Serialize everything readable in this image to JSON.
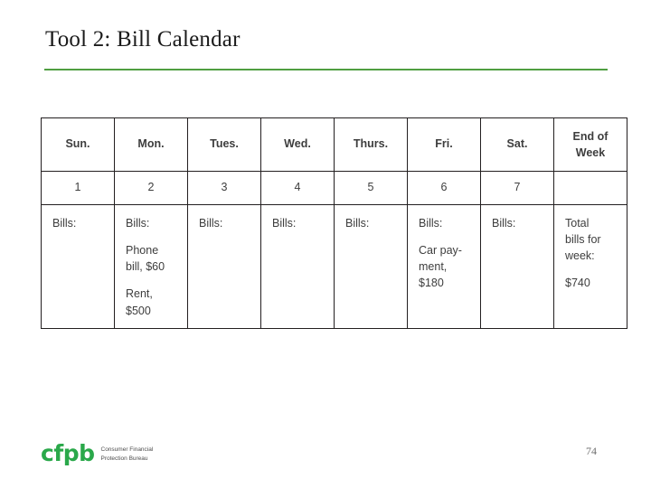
{
  "slide": {
    "title": "Tool 2: Bill Calendar",
    "page_number": "74",
    "accent_color": "#4f9e41",
    "logo": {
      "mark": "cfpb",
      "line1": "Consumer Financial",
      "line2": "Protection Bureau",
      "mark_color": "#2aa84a"
    }
  },
  "calendar": {
    "headers": [
      {
        "label": "Sun.",
        "lines": [
          "Sun."
        ]
      },
      {
        "label": "Mon.",
        "lines": [
          "Mon."
        ]
      },
      {
        "label": "Tues.",
        "lines": [
          "Tues."
        ]
      },
      {
        "label": "Wed.",
        "lines": [
          "Wed."
        ]
      },
      {
        "label": "Thurs.",
        "lines": [
          "Thurs."
        ]
      },
      {
        "label": "Fri.",
        "lines": [
          "Fri."
        ]
      },
      {
        "label": "Sat.",
        "lines": [
          "Sat."
        ]
      },
      {
        "label": "End of Week",
        "lines": [
          "End of",
          "Week"
        ]
      }
    ],
    "day_numbers": [
      "1",
      "2",
      "3",
      "4",
      "5",
      "6",
      "7",
      ""
    ],
    "cells": [
      {
        "lines": [
          "Bills:"
        ]
      },
      {
        "lines": [
          "Bills:",
          "Phone bill, $60",
          "Rent, $500"
        ]
      },
      {
        "lines": [
          "Bills:"
        ]
      },
      {
        "lines": [
          "Bills:"
        ]
      },
      {
        "lines": [
          "Bills:"
        ]
      },
      {
        "lines": [
          "Bills:",
          "Car pay-ment, $180"
        ]
      },
      {
        "lines": [
          "Bills:"
        ]
      },
      {
        "lines": [
          "Total bills for week:",
          "$740"
        ]
      }
    ],
    "cells_wrapped": {
      "sun": [
        "Bills:"
      ],
      "mon": [
        "Bills:",
        "Phone",
        "bill, $60",
        "Rent,",
        "$500"
      ],
      "tues": [
        "Bills:"
      ],
      "wed": [
        "Bills:"
      ],
      "thurs": [
        "Bills:"
      ],
      "fri": [
        "Bills:",
        "Car pay-",
        "ment,",
        "$180"
      ],
      "sat": [
        "Bills:"
      ],
      "eow": [
        "Total",
        "bills for",
        "week:",
        "$740"
      ]
    }
  }
}
